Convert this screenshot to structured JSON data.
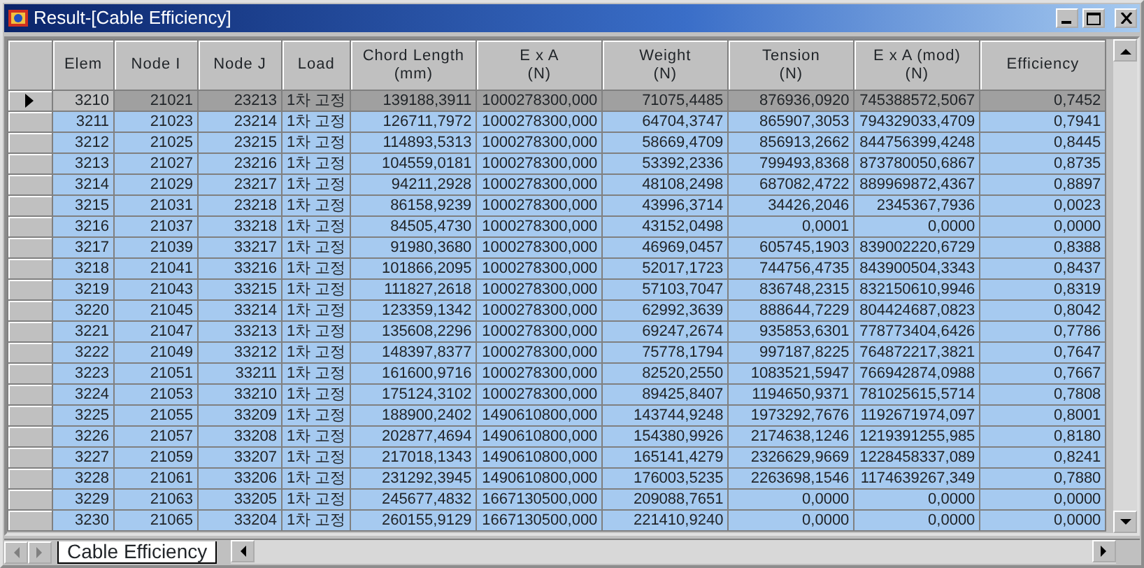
{
  "window": {
    "title": "Result-[Cable Efficiency]"
  },
  "table": {
    "columns": [
      {
        "label": "Elem"
      },
      {
        "label": "Node I"
      },
      {
        "label": "Node J"
      },
      {
        "label": "Load"
      },
      {
        "label": "Chord Length",
        "unit": "(mm)"
      },
      {
        "label": "E x A",
        "unit": "(N)"
      },
      {
        "label": "Weight",
        "unit": "(N)"
      },
      {
        "label": "Tension",
        "unit": "(N)"
      },
      {
        "label": "E x A (mod)",
        "unit": "(N)"
      },
      {
        "label": "Efficiency"
      }
    ],
    "rows": [
      {
        "selected": true,
        "cells": [
          "3210",
          "21021",
          "23213",
          "1차 고정",
          "139188,3911",
          "1000278300,000",
          "71075,4485",
          "876936,0920",
          "745388572,5067",
          "0,7452"
        ]
      },
      {
        "selected": false,
        "cells": [
          "3211",
          "21023",
          "23214",
          "1차 고정",
          "126711,7972",
          "1000278300,000",
          "64704,3747",
          "865907,3053",
          "794329033,4709",
          "0,7941"
        ]
      },
      {
        "selected": false,
        "cells": [
          "3212",
          "21025",
          "23215",
          "1차 고정",
          "114893,5313",
          "1000278300,000",
          "58669,4709",
          "856913,2662",
          "844756399,4248",
          "0,8445"
        ]
      },
      {
        "selected": false,
        "cells": [
          "3213",
          "21027",
          "23216",
          "1차 고정",
          "104559,0181",
          "1000278300,000",
          "53392,2336",
          "799493,8368",
          "873780050,6867",
          "0,8735"
        ]
      },
      {
        "selected": false,
        "cells": [
          "3214",
          "21029",
          "23217",
          "1차 고정",
          "94211,2928",
          "1000278300,000",
          "48108,2498",
          "687082,4722",
          "889969872,4367",
          "0,8897"
        ]
      },
      {
        "selected": false,
        "cells": [
          "3215",
          "21031",
          "23218",
          "1차 고정",
          "86158,9239",
          "1000278300,000",
          "43996,3714",
          "34426,2046",
          "2345367,7936",
          "0,0023"
        ]
      },
      {
        "selected": false,
        "cells": [
          "3216",
          "21037",
          "33218",
          "1차 고정",
          "84505,4730",
          "1000278300,000",
          "43152,0498",
          "0,0001",
          "0,0000",
          "0,0000"
        ]
      },
      {
        "selected": false,
        "cells": [
          "3217",
          "21039",
          "33217",
          "1차 고정",
          "91980,3680",
          "1000278300,000",
          "46969,0457",
          "605745,1903",
          "839002220,6729",
          "0,8388"
        ]
      },
      {
        "selected": false,
        "cells": [
          "3218",
          "21041",
          "33216",
          "1차 고정",
          "101866,2095",
          "1000278300,000",
          "52017,1723",
          "744756,4735",
          "843900504,3343",
          "0,8437"
        ]
      },
      {
        "selected": false,
        "cells": [
          "3219",
          "21043",
          "33215",
          "1차 고정",
          "111827,2618",
          "1000278300,000",
          "57103,7047",
          "836748,2315",
          "832150610,9946",
          "0,8319"
        ]
      },
      {
        "selected": false,
        "cells": [
          "3220",
          "21045",
          "33214",
          "1차 고정",
          "123359,1342",
          "1000278300,000",
          "62992,3639",
          "888644,7229",
          "804424687,0823",
          "0,8042"
        ]
      },
      {
        "selected": false,
        "cells": [
          "3221",
          "21047",
          "33213",
          "1차 고정",
          "135608,2296",
          "1000278300,000",
          "69247,2674",
          "935853,6301",
          "778773404,6426",
          "0,7786"
        ]
      },
      {
        "selected": false,
        "cells": [
          "3222",
          "21049",
          "33212",
          "1차 고정",
          "148397,8377",
          "1000278300,000",
          "75778,1794",
          "997187,8225",
          "764872217,3821",
          "0,7647"
        ]
      },
      {
        "selected": false,
        "cells": [
          "3223",
          "21051",
          "33211",
          "1차 고정",
          "161600,9716",
          "1000278300,000",
          "82520,2550",
          "1083521,5947",
          "766942874,0988",
          "0,7667"
        ]
      },
      {
        "selected": false,
        "cells": [
          "3224",
          "21053",
          "33210",
          "1차 고정",
          "175124,3102",
          "1000278300,000",
          "89425,8407",
          "1194650,9371",
          "781025615,5714",
          "0,7808"
        ]
      },
      {
        "selected": false,
        "cells": [
          "3225",
          "21055",
          "33209",
          "1차 고정",
          "188900,2402",
          "1490610800,000",
          "143744,9248",
          "1973292,7676",
          "1192671974,097",
          "0,8001"
        ]
      },
      {
        "selected": false,
        "cells": [
          "3226",
          "21057",
          "33208",
          "1차 고정",
          "202877,4694",
          "1490610800,000",
          "154380,9926",
          "2174638,1246",
          "1219391255,985",
          "0,8180"
        ]
      },
      {
        "selected": false,
        "cells": [
          "3227",
          "21059",
          "33207",
          "1차 고정",
          "217018,1343",
          "1490610800,000",
          "165141,4279",
          "2326629,9669",
          "1228458337,089",
          "0,8241"
        ]
      },
      {
        "selected": false,
        "cells": [
          "3228",
          "21061",
          "33206",
          "1차 고정",
          "231292,3945",
          "1490610800,000",
          "176003,5235",
          "2263698,1546",
          "1174639267,349",
          "0,7880"
        ]
      },
      {
        "selected": false,
        "cells": [
          "3229",
          "21063",
          "33205",
          "1차 고정",
          "245677,4832",
          "1667130500,000",
          "209088,7651",
          "0,0000",
          "0,0000",
          "0,0000"
        ]
      },
      {
        "selected": false,
        "cells": [
          "3230",
          "21065",
          "33204",
          "1차 고정",
          "260155,9129",
          "1667130500,000",
          "221410,9240",
          "0,0000",
          "0,0000",
          "0,0000"
        ]
      }
    ]
  },
  "sheet_tabs": [
    {
      "label": "Cable Efficiency",
      "selected": true
    }
  ]
}
